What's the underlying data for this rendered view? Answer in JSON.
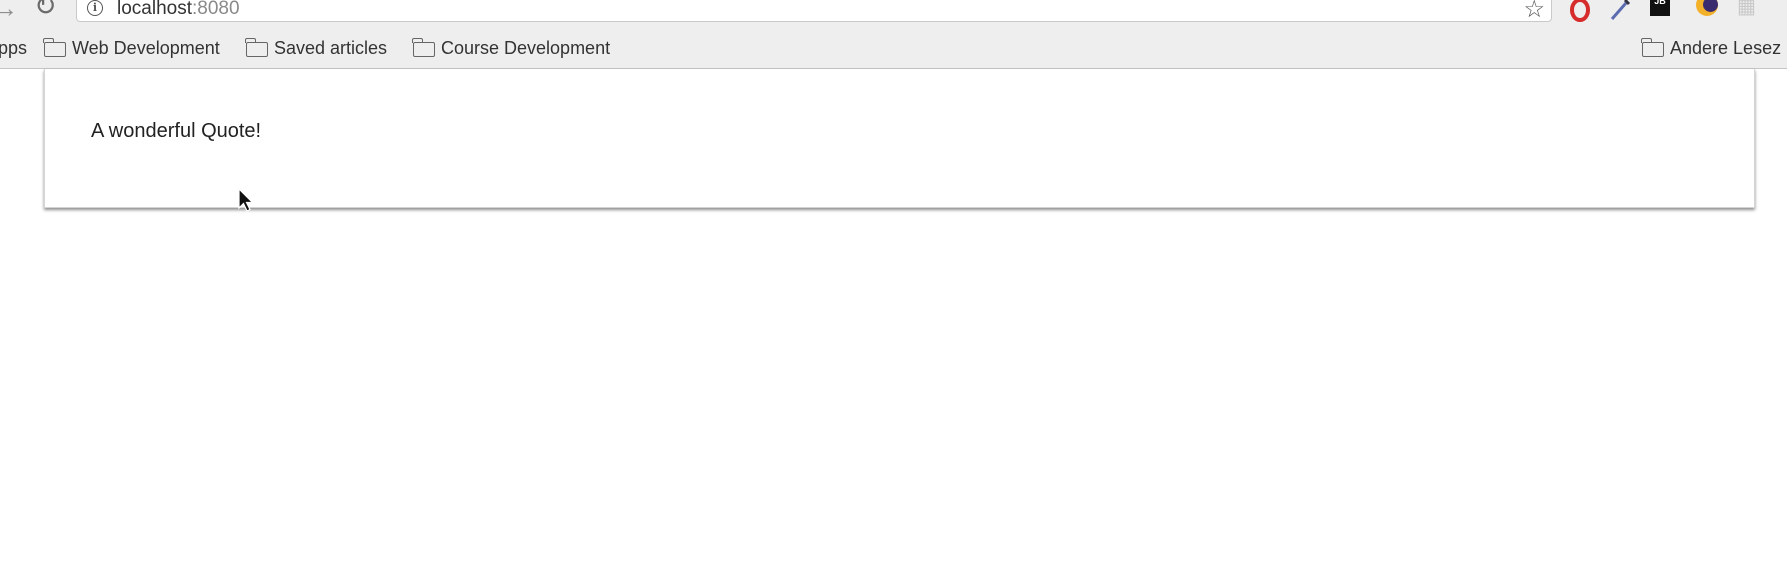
{
  "browser": {
    "url_host": "localhost",
    "url_port": ":8080",
    "extensions": [
      "opera-icon",
      "pen-icon",
      "jetbrains-icon",
      "moon-icon",
      "extension-icon"
    ]
  },
  "bookmarks": {
    "apps_label": "pps",
    "items": [
      {
        "label": "Web Development",
        "icon": "folder-icon"
      },
      {
        "label": "Saved articles",
        "icon": "folder-icon"
      },
      {
        "label": "Course Development",
        "icon": "folder-icon"
      }
    ],
    "other_label": "Andere Lesez"
  },
  "page": {
    "quote": "A wonderful Quote!"
  },
  "colors": {
    "toolbar_bg": "#eeeeee",
    "page_bg": "#ffffff",
    "text": "#222222"
  }
}
